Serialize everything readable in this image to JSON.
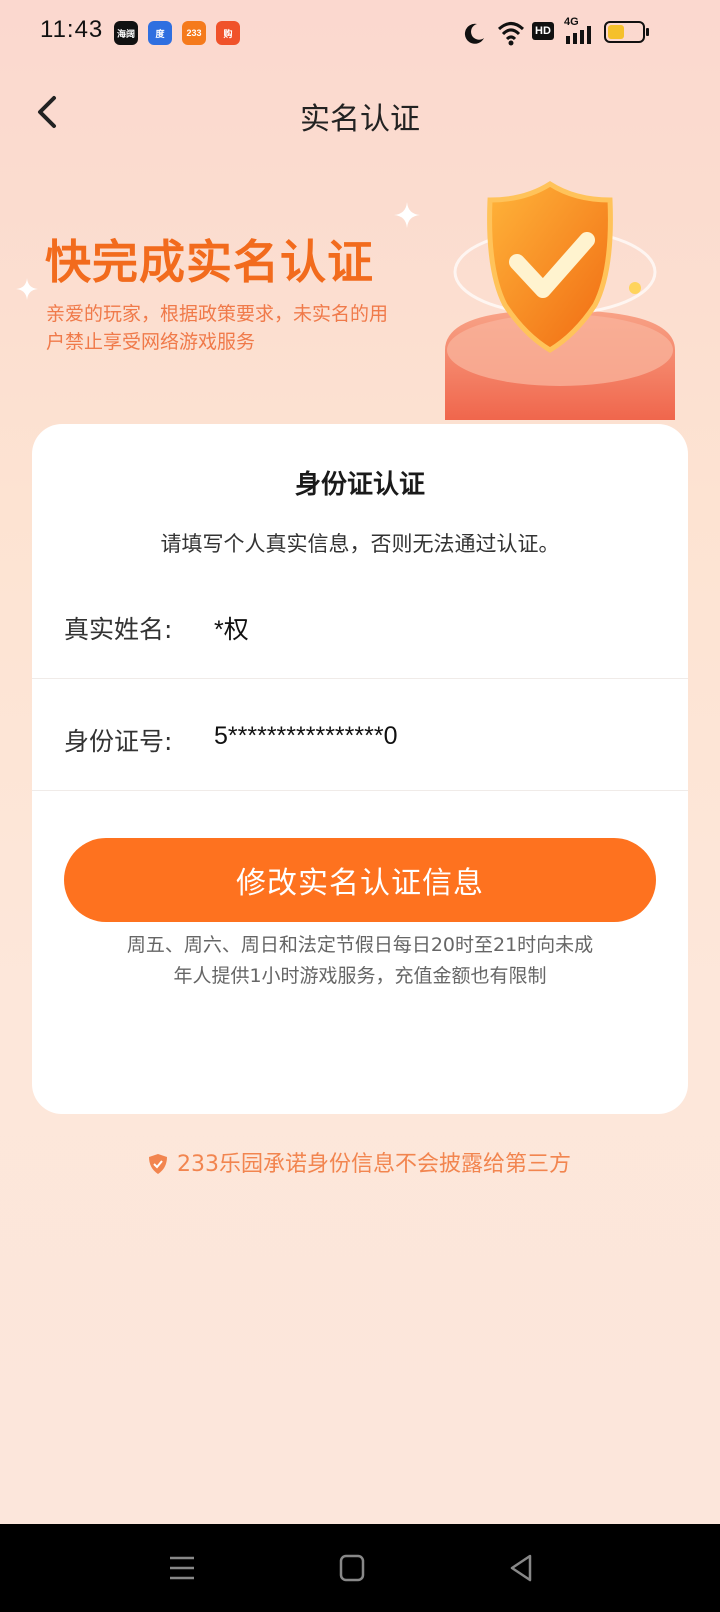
{
  "status_bar": {
    "time": "11:43",
    "app_icons": [
      "海阔",
      "度",
      "233",
      "购"
    ],
    "network": "4G",
    "hd": "HD"
  },
  "nav": {
    "title": "实名认证"
  },
  "hero": {
    "title": "快完成实名认证",
    "description": "亲爱的玩家，根据政策要求，未实名的用户禁止享受网络游戏服务"
  },
  "card": {
    "title": "身份证认证",
    "subtitle": "请填写个人真实信息，否则无法通过认证。",
    "fields": [
      {
        "label": "真实姓名:",
        "value": "*权"
      },
      {
        "label": "身份证号:",
        "value": "5****************0"
      }
    ],
    "button_label": "修改实名认证信息",
    "notice": "周五、周六、周日和法定节假日每日20时至21时向未成年人提供1小时游戏服务，充值金额也有限制"
  },
  "footer": {
    "promise": "233乐园承诺身份信息不会披露给第三方"
  },
  "colors": {
    "accent": "#fe721f",
    "hero_title": "#f26b1d",
    "hero_desc": "#f07a4a",
    "promise": "#f2854f"
  },
  "icons": [
    "back-icon",
    "shield-check-icon",
    "moon-icon",
    "wifi-icon",
    "signal-icon",
    "battery-icon",
    "menu-icon",
    "home-icon",
    "back-triangle-icon"
  ]
}
